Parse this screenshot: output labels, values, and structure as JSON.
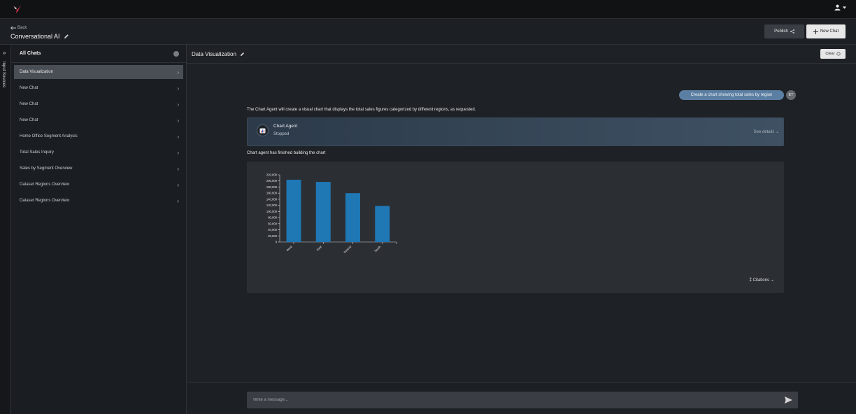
{
  "topbar": {
    "logo_icon": "hummingbird-logo-icon",
    "user_icon": "user-icon"
  },
  "header": {
    "back_label": "Back",
    "app_title": "Conversational AI",
    "publish_label": "Publish",
    "new_chat_label": "New Chat"
  },
  "rail": {
    "label": "Input Sources"
  },
  "sidebar": {
    "title": "All Chats",
    "items": [
      {
        "label": "Data Visualization",
        "active": true
      },
      {
        "label": "New Chat"
      },
      {
        "label": "New Chat"
      },
      {
        "label": "New Chat"
      },
      {
        "label": "Home Office Segment Analysis"
      },
      {
        "label": "Total Sales Inquiry"
      },
      {
        "label": "Sales by Segment Overview"
      },
      {
        "label": "Dataset Regions Overview"
      },
      {
        "label": "Dataset Regions Overview"
      }
    ]
  },
  "main": {
    "title": "Data Visualization",
    "clear_label": "Clear",
    "user_message": "Create a chart showing total sales by region",
    "user_initials": "ET",
    "response_text": "The Chart Agent will create a visual chart that displays the total sales figures categorized by different regions, as requested.",
    "agent": {
      "name": "Chart Agent",
      "status": "Stopped",
      "see_details": "See details"
    },
    "finished_text": "Chart agent has finished building the chart",
    "citations_label": "Citations",
    "input_placeholder": "Write a message..."
  },
  "colors": {
    "bar": "#1f77b4",
    "user_bubble": "#5b7fa3",
    "accent_light": "#e8e8e8"
  },
  "chart_data": {
    "type": "bar",
    "categories": [
      "West",
      "East",
      "Central",
      "South"
    ],
    "values": [
      204000,
      197000,
      160000,
      118000
    ],
    "ylim": [
      0,
      220000
    ],
    "yticks": [
      "0",
      "20,000",
      "40,000",
      "60,000",
      "80,000",
      "100,000",
      "120,000",
      "140,000",
      "160,000",
      "180,000",
      "200,000",
      "220,000"
    ],
    "title": "",
    "xlabel": "",
    "ylabel": ""
  }
}
